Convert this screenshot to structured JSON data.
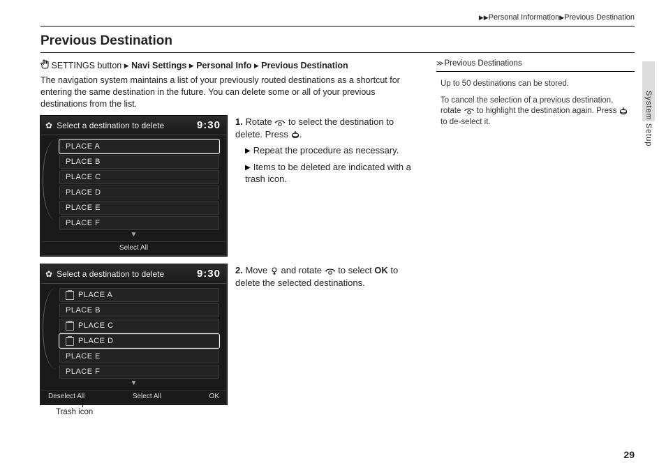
{
  "breadcrumb": {
    "item1": "Personal Information",
    "item2": "Previous Destination"
  },
  "heading": "Previous Destination",
  "path": {
    "prefix": "SETTINGS button",
    "p1": "Navi Settings",
    "p2": "Personal Info",
    "p3": "Previous Destination"
  },
  "intro": "The navigation system maintains a list of your previously routed destinations as a shortcut for entering the same destination in the future. You can delete some or all of your previous destinations from the list.",
  "screens": {
    "title": "Select a destination to delete",
    "time": "9:30",
    "items": [
      "PLACE A",
      "PLACE B",
      "PLACE C",
      "PLACE D",
      "PLACE E",
      "PLACE F"
    ],
    "select_all": "Select All",
    "deselect_all": "Deselect All",
    "ok": "OK"
  },
  "trash_label": "Trash icon",
  "steps": {
    "s1_num": "1.",
    "s1_a": "Rotate ",
    "s1_b": " to select the destination to delete. Press ",
    "s1_c": ".",
    "s1_sub1": "Repeat the procedure as necessary.",
    "s1_sub2": "Items to be deleted are indicated with a trash icon.",
    "s2_num": "2.",
    "s2_a": "Move ",
    "s2_b": " and rotate ",
    "s2_c": " to select ",
    "s2_ok": "OK",
    "s2_d": " to delete the selected destinations."
  },
  "sidebar": {
    "head": "Previous Destinations",
    "p1": "Up to 50 destinations can be stored.",
    "p2a": "To cancel the selection of a previous destination, rotate ",
    "p2b": " to highlight the destination again. Press ",
    "p2c": " to de-select it."
  },
  "side_tab_label": "System Setup",
  "page_number": "29"
}
